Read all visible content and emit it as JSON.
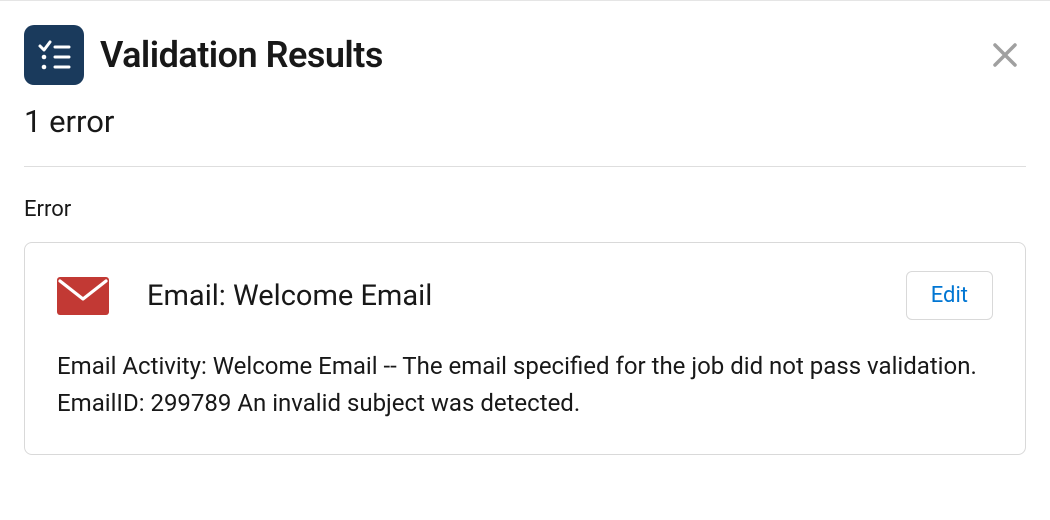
{
  "header": {
    "title": "Validation Results"
  },
  "summary": {
    "count_label": "1 error"
  },
  "section": {
    "label": "Error"
  },
  "error_card": {
    "title": "Email: Welcome Email",
    "edit_label": "Edit",
    "message": "Email Activity: Welcome Email -- The email specified for the job did not pass validation. EmailID: 299789 An invalid subject was detected."
  }
}
